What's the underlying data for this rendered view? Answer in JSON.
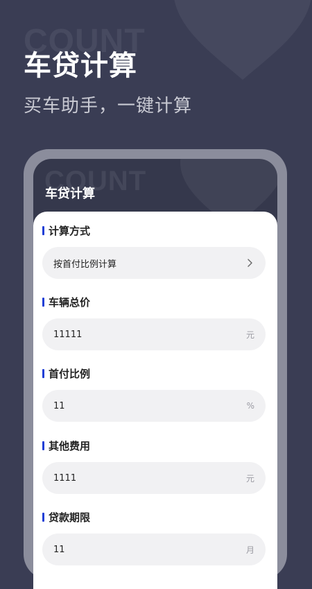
{
  "hero": {
    "watermark": "COUNT",
    "title": "车贷计算",
    "subtitle": "买车助手，一键计算"
  },
  "screen": {
    "watermark": "COUNT",
    "title": "车贷计算"
  },
  "form": {
    "method": {
      "label": "计算方式",
      "value": "按首付比例计算",
      "icon": "chevron-right-icon"
    },
    "total_price": {
      "label": "车辆总价",
      "value": "11111",
      "unit": "元"
    },
    "down_payment_ratio": {
      "label": "首付比例",
      "value": "11",
      "unit": "%"
    },
    "other_fees": {
      "label": "其他费用",
      "value": "1111",
      "unit": "元"
    },
    "loan_term": {
      "label": "贷款期限",
      "value": "11",
      "unit": "月"
    }
  },
  "colors": {
    "background": "#3a3d54",
    "accent_bar": "#1f3fd6",
    "field_bg": "#f1f1f3"
  }
}
